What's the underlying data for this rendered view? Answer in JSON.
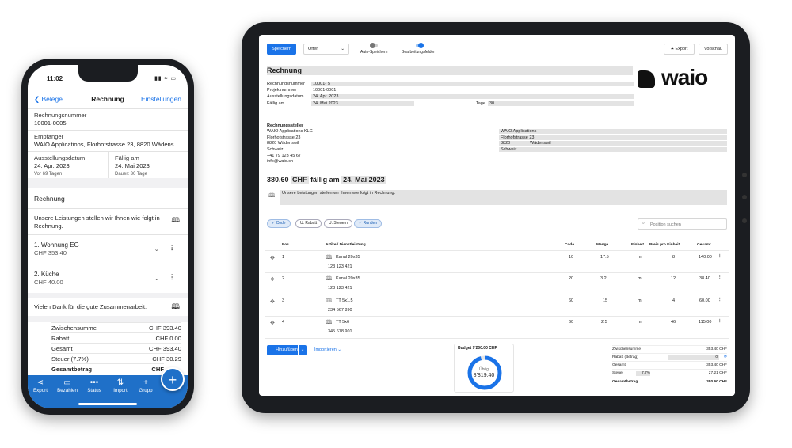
{
  "phone": {
    "status_time": "11:02",
    "nav": {
      "back": "Belege",
      "title": "Rechnung",
      "settings": "Einstellungen"
    },
    "rechnungsnummer": {
      "label": "Rechnungsnummer",
      "value": "10001-0005"
    },
    "empfaenger": {
      "label": "Empfänger",
      "value": "WAIO Applications, Florhofstrasse 23, 8820 Wädens…"
    },
    "ausstellungsdatum": {
      "label": "Ausstellungsdatum",
      "value": "24. Apr. 2023",
      "sub": "Vor 69 Tagen"
    },
    "faellig": {
      "label": "Fällig am",
      "value": "24. Mai 2023",
      "sub": "Dauer: 30 Tage"
    },
    "heading": "Rechnung",
    "intro": "Unsere Leistungen stellen wir Ihnen wie folgt in Rechnung.",
    "items": [
      {
        "title": "1. Wohnung EG",
        "amount": "CHF 353.40"
      },
      {
        "title": "2. Küche",
        "amount": "CHF 40.00"
      }
    ],
    "outro": "Vielen Dank für die gute Zusammenarbeit.",
    "totals": [
      {
        "label": "Zwischensumme",
        "value": "CHF 393.40"
      },
      {
        "label": "Rabatt",
        "value": "CHF 0.00"
      },
      {
        "label": "Gesamt",
        "value": "CHF 393.40"
      },
      {
        "label": "Steuer (7.7%)",
        "value": "CHF 30.29"
      },
      {
        "label": "Gesamtbetrag",
        "value": "CHF"
      }
    ],
    "tabs": [
      "Export",
      "Bezahlen",
      "Status",
      "Import",
      "Grupp"
    ],
    "fab": "+"
  },
  "tablet": {
    "toolbar": {
      "save": "Speichern",
      "status": "Offen",
      "auto_save": "Auto-Speichern",
      "edit_fields": "Bearbeitungsfelder",
      "export": "Export",
      "preview": "Vorschau"
    },
    "logo": "waio",
    "title": "Rechnung",
    "meta": [
      {
        "label": "Rechnungsnummer",
        "value": "10001-",
        "value2": "5"
      },
      {
        "label": "Projektnummer",
        "value": "10001-0001"
      },
      {
        "label": "Ausstellungsdatum",
        "value": "24. Apr. 2023"
      },
      {
        "label": "Fällig am",
        "value": "24. Mai 2023",
        "extra_label": "Tage",
        "extra_value": "30"
      }
    ],
    "sender": {
      "label": "Rechnungssteller",
      "lines": [
        "WAIO Applications KLG",
        "Florhofstrasse 23",
        "8820 Wädenswil",
        "Schweiz",
        "+41 79 123 45 67",
        "info@waio.ch"
      ]
    },
    "recipient": {
      "lines": [
        "WAIO Applications",
        "Florhofstrasse 23",
        "8820",
        "Wädenswil",
        "Schweiz"
      ]
    },
    "amount": {
      "value": "380.60",
      "currency": "CHF",
      "due": "fällig am",
      "date": "24. Mai 2023"
    },
    "intro": "Unsere Leistungen stellen wir Ihnen wie folgt in Rechnung.",
    "chips": [
      "Code",
      "U. Rabatt",
      "U. Steuern",
      "Runden"
    ],
    "search_placeholder": "Position suchen",
    "headers": [
      "Pos.",
      "Artikel/ Dienstleistung",
      "Code",
      "Menge",
      "Einheit",
      "Preis pro Einheit",
      "Gesamt"
    ],
    "rows": [
      {
        "pos": "1",
        "name": "Kanal 20x35",
        "sub": "123 123 421",
        "code": "10",
        "qty": "17.5",
        "unit": "m",
        "price": "8",
        "total": "140.00"
      },
      {
        "pos": "2",
        "name": "Kanal 20x35",
        "sub": "123 123 421",
        "code": "20",
        "qty": "3.2",
        "unit": "m",
        "price": "12",
        "total": "38.40"
      },
      {
        "pos": "3",
        "name": "TT 5x1.5",
        "sub": "234 567 890",
        "code": "60",
        "qty": "15",
        "unit": "m",
        "price": "4",
        "total": "60.00"
      },
      {
        "pos": "4",
        "name": "TT 5x6",
        "sub": "345 678 901",
        "code": "60",
        "qty": "2.5",
        "unit": "m",
        "price": "46",
        "total": "115.00"
      }
    ],
    "add": "Hinzufügen",
    "import": "Importieren",
    "budget": {
      "title": "Budget 9'200.00 CHF",
      "label": "Übrig",
      "value": "8'819.40",
      "remaining_fraction": 0.96
    },
    "totals": [
      {
        "label": "Zwischensumme",
        "value": "353.40 CHF"
      },
      {
        "label": "Rabatt (Betrag)",
        "value": "0"
      },
      {
        "label": "Gesamt",
        "value": "353.40 CHF"
      },
      {
        "label": "Steuer",
        "mid": "7.7%",
        "value": "27.21 CHF"
      },
      {
        "label": "Gesamtbetrag",
        "value": "380.60 CHF"
      }
    ]
  }
}
